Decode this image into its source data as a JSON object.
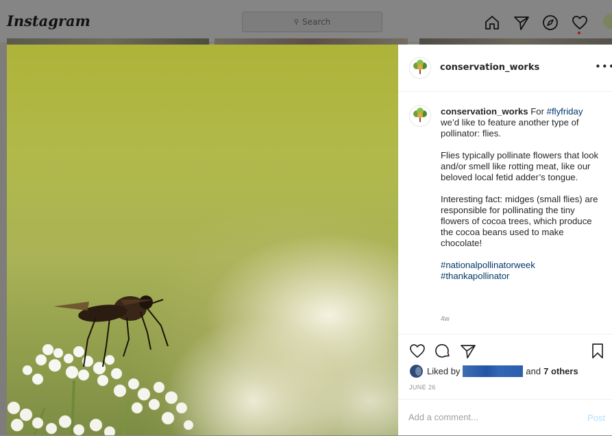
{
  "app": {
    "logo_text": "Instagram",
    "search_placeholder": "Search"
  },
  "nav_icons": [
    "home-icon",
    "direct-message-icon",
    "explore-compass-icon",
    "activity-heart-icon",
    "profile-avatar-icon"
  ],
  "post": {
    "username": "conservation_works",
    "caption": {
      "intro_before_tag": "For ",
      "intro_tag": "#flyfriday",
      "intro_after_tag": " we’d like to feature another type of pollinator: flies.",
      "para2": "Flies typically pollinate flowers that look and/or smell like rotting meat, like our beloved local fetid adder’s tongue.",
      "para3": "Interesting fact: midges (small flies) are responsible for pollinating the tiny flowers of cocoa trees, which produce the cocoa beans used to make chocolate!",
      "hashtag1": "#nationalpollinatorweek",
      "hashtag2": "#thankapollinator"
    },
    "time_ago": "4w",
    "likes": {
      "prefix": "Liked by",
      "suffix_and": "and",
      "others": "7 others"
    },
    "date": "JUNE 26",
    "comment": {
      "placeholder": "Add a comment...",
      "post_label": "Post"
    },
    "more_label": "•••"
  },
  "colors": {
    "link_blue": "#00376b",
    "post_button_disabled": "#b2dffc",
    "meta_gray": "#8e8e8e"
  }
}
